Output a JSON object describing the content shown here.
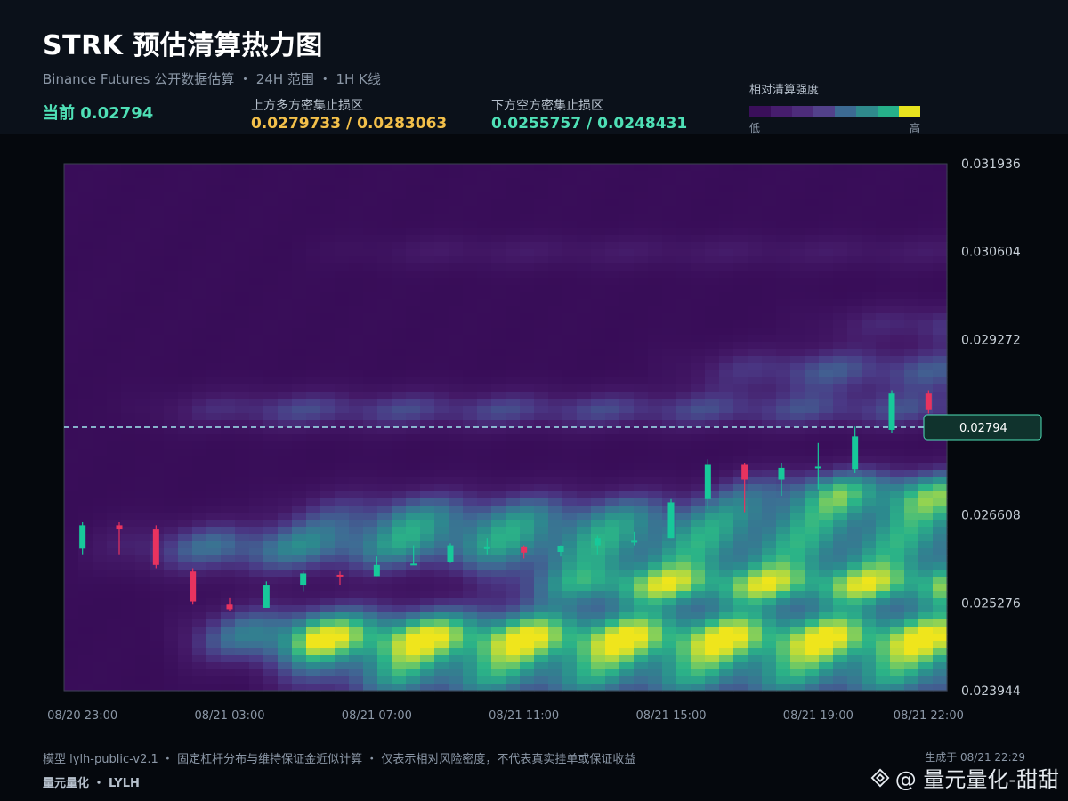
{
  "header": {
    "title": "STRK 预估清算热力图",
    "subtitle": "Binance Futures 公开数据估算 ・ 24H 范围 ・ 1H K线",
    "current_label": "当前 0.02794",
    "upper_zone_label": "上方多方密集止损区",
    "upper_zone_value": "0.0279733 / 0.0283063",
    "lower_zone_label": "下方空方密集止损区",
    "lower_zone_value": "0.0255757 / 0.0248431"
  },
  "legend": {
    "title": "相对清算强度",
    "low": "低",
    "high": "高",
    "colors": [
      "#3a0f5a",
      "#461d6d",
      "#4d2c7a",
      "#52418a",
      "#3c6a92",
      "#2f8a8c",
      "#26b089",
      "#e8e41e"
    ]
  },
  "chart_data": {
    "type": "heatmap",
    "title": "STRK 预估清算热力图",
    "y_ticks": [
      "0.031936",
      "0.030604",
      "0.029272",
      "0.026608",
      "0.025276",
      "0.023944"
    ],
    "x_ticks": [
      "08/20 23:00",
      "08/21 03:00",
      "08/21 07:00",
      "08/21 11:00",
      "08/21 15:00",
      "08/21 19:00",
      "08/21 22:00"
    ],
    "ylim": [
      0.023944,
      0.031936
    ],
    "current_price": 0.02794,
    "current_price_label": "0.02794",
    "upper_zones": [
      0.0279733,
      0.0283063
    ],
    "lower_zones": [
      0.0255757,
      0.0248431
    ],
    "colors": {
      "up": "#17c99a",
      "down": "#e8335f",
      "price_line": "#9fe8ef"
    },
    "candles": [
      {
        "time": "08/20 23:00",
        "open": 0.0261,
        "high": 0.0265,
        "low": 0.026,
        "close": 0.02645
      },
      {
        "time": "08/21 00:00",
        "open": 0.02645,
        "high": 0.0265,
        "low": 0.026,
        "close": 0.0264
      },
      {
        "time": "08/21 01:00",
        "open": 0.0264,
        "high": 0.02645,
        "low": 0.0258,
        "close": 0.02585
      },
      {
        "time": "08/21 02:00",
        "open": 0.02575,
        "high": 0.0258,
        "low": 0.02525,
        "close": 0.0253
      },
      {
        "time": "08/21 03:00",
        "open": 0.02525,
        "high": 0.02535,
        "low": 0.02515,
        "close": 0.02518
      },
      {
        "time": "08/21 04:00",
        "open": 0.0252,
        "high": 0.0256,
        "low": 0.0252,
        "close": 0.02555
      },
      {
        "time": "08/21 05:00",
        "open": 0.02555,
        "high": 0.02575,
        "low": 0.02545,
        "close": 0.02572
      },
      {
        "time": "08/21 06:00",
        "open": 0.0257,
        "high": 0.02575,
        "low": 0.02555,
        "close": 0.02568
      },
      {
        "time": "08/21 07:00",
        "open": 0.02568,
        "high": 0.02598,
        "low": 0.02568,
        "close": 0.02585
      },
      {
        "time": "08/21 08:00",
        "open": 0.02585,
        "high": 0.02615,
        "low": 0.02585,
        "close": 0.02587
      },
      {
        "time": "08/21 09:00",
        "open": 0.0259,
        "high": 0.02618,
        "low": 0.02588,
        "close": 0.02615
      },
      {
        "time": "08/21 10:00",
        "open": 0.0261,
        "high": 0.02625,
        "low": 0.026,
        "close": 0.02612
      },
      {
        "time": "08/21 11:00",
        "open": 0.02612,
        "high": 0.02615,
        "low": 0.02595,
        "close": 0.02604
      },
      {
        "time": "08/21 12:00",
        "open": 0.02605,
        "high": 0.02615,
        "low": 0.02598,
        "close": 0.02614
      },
      {
        "time": "08/21 13:00",
        "open": 0.02615,
        "high": 0.0263,
        "low": 0.026,
        "close": 0.02625
      },
      {
        "time": "08/21 14:00",
        "open": 0.0262,
        "high": 0.02635,
        "low": 0.02615,
        "close": 0.02622
      },
      {
        "time": "08/21 15:00",
        "open": 0.02625,
        "high": 0.02685,
        "low": 0.02625,
        "close": 0.0268
      },
      {
        "time": "08/21 16:00",
        "open": 0.02685,
        "high": 0.02745,
        "low": 0.0267,
        "close": 0.02738
      },
      {
        "time": "08/21 17:00",
        "open": 0.02738,
        "high": 0.0274,
        "low": 0.02665,
        "close": 0.02715
      },
      {
        "time": "08/21 18:00",
        "open": 0.02715,
        "high": 0.0274,
        "low": 0.0269,
        "close": 0.02732
      },
      {
        "time": "08/21 19:00",
        "open": 0.02732,
        "high": 0.0277,
        "low": 0.027,
        "close": 0.02734
      },
      {
        "time": "08/21 20:00",
        "open": 0.0273,
        "high": 0.02795,
        "low": 0.02725,
        "close": 0.0278
      },
      {
        "time": "08/21 21:00",
        "open": 0.0279,
        "high": 0.0285,
        "low": 0.02785,
        "close": 0.02845
      },
      {
        "time": "08/21 22:00",
        "open": 0.02845,
        "high": 0.0285,
        "low": 0.02815,
        "close": 0.0282
      }
    ],
    "heat_bands": [
      {
        "center": 0.02475,
        "width": 0.00045,
        "start": 0.1,
        "strength": 1.0
      },
      {
        "center": 0.02555,
        "width": 0.00035,
        "start": 0.45,
        "strength": 0.85
      },
      {
        "center": 0.0261,
        "width": 0.0004,
        "start": 0.0,
        "strength": 0.55
      },
      {
        "center": 0.0266,
        "width": 0.0004,
        "start": 0.2,
        "strength": 0.5
      },
      {
        "center": 0.027,
        "width": 0.00035,
        "start": 0.7,
        "strength": 0.6
      },
      {
        "center": 0.0282,
        "width": 0.0003,
        "start": 0.05,
        "strength": 0.35
      },
      {
        "center": 0.0288,
        "width": 0.00035,
        "start": 0.65,
        "strength": 0.4
      },
      {
        "center": 0.0295,
        "width": 0.0003,
        "start": 0.8,
        "strength": 0.3
      },
      {
        "center": 0.0306,
        "width": 0.00025,
        "start": 0.25,
        "strength": 0.15
      },
      {
        "center": 0.0241,
        "width": 0.0004,
        "start": 0.2,
        "strength": 0.55
      }
    ]
  },
  "footer": {
    "model_note": "模型 lylh-public-v2.1 ・ 固定杠杆分布与维持保证金近似计算 ・ 仅表示相对风险密度，不代表真实挂单或保证收益",
    "brand": "量元量化 ・ LYLH",
    "generated": "生成于 08/21 22:29",
    "watermark": "@ 量元量化-甜甜"
  }
}
